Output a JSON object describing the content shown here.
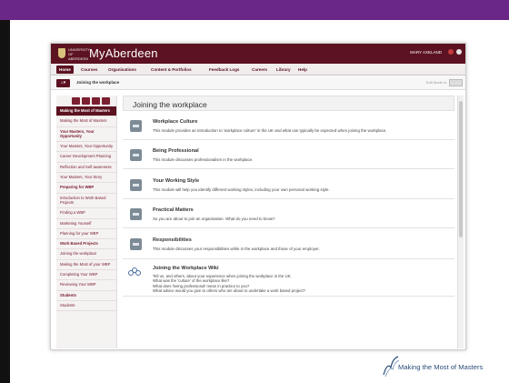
{
  "app": {
    "name": "MyAberdeen",
    "university": "UNIVERSITY OF ABERDEEN",
    "user": "MARY AXELAND"
  },
  "nav": [
    "Home",
    "Courses",
    "Organisations",
    "Content & Portfolios",
    "Feedback Logs",
    "Careers",
    "Library",
    "Help"
  ],
  "breadcrumb": {
    "current": "Joining the workplace",
    "right": "Edit Mode is:"
  },
  "toc": [
    {
      "label": "Making the Most of Masters",
      "type": "active"
    },
    {
      "label": "Making the Most of Masters",
      "type": "link"
    },
    {
      "label": "Your Masters, Your Opportunity",
      "type": "section"
    },
    {
      "label": "Your Masters, Your Opportunity",
      "type": "link"
    },
    {
      "label": "Career Development Planning",
      "type": "link"
    },
    {
      "label": "Reflection and Self awareness",
      "type": "link"
    },
    {
      "label": "Your Masters, Your Story",
      "type": "link"
    },
    {
      "label": "Preparing for WBP",
      "type": "section"
    },
    {
      "label": "Introduction to Work Based Projects",
      "type": "link"
    },
    {
      "label": "Finding a WBP",
      "type": "link"
    },
    {
      "label": "Marketing Yourself",
      "type": "link"
    },
    {
      "label": "Planning for your WBP",
      "type": "link"
    },
    {
      "label": "Work Based Projects",
      "type": "section"
    },
    {
      "label": "Joining the workplace",
      "type": "link"
    },
    {
      "label": "Making the Most of your WBP",
      "type": "link"
    },
    {
      "label": "Completing Your WBP",
      "type": "link"
    },
    {
      "label": "Reviewing Your WBP",
      "type": "link"
    },
    {
      "label": "Students",
      "type": "section"
    },
    {
      "label": "Students",
      "type": "link"
    }
  ],
  "main": {
    "title": "Joining the workplace",
    "modules": [
      {
        "title": "Workplace Culture",
        "desc": "This module provides an introduction to 'workplace culture' in the UK and what can typically be expected when joining the workplace."
      },
      {
        "title": "Being Professional",
        "desc": "This module discusses professionalism in the workplace."
      },
      {
        "title": "Your Working Style",
        "desc": "This module will help you identify different working styles, including your own personal working style."
      },
      {
        "title": "Practical Matters",
        "desc": "So you are about to join an organisation. What do you need to know?"
      },
      {
        "title": "Responsibilities",
        "desc": "This module discusses your responsibilities while in the workplace and those of your employer."
      }
    ],
    "wiki": {
      "title": "Joining the Workplace Wiki",
      "lines": [
        "Tell us, and others, about your experience when joining the workplace in the UK.",
        "What was the 'culture' of the workplace like?",
        "What does 'being professional' mean in practice to you?",
        "What advice would you give to others who are about to undertake a work based project?"
      ]
    }
  },
  "brand": {
    "text": "Making the Most of Masters"
  },
  "colors": {
    "topbar": "#6b2787",
    "header": "#5c1220",
    "link": "#7a2030"
  }
}
